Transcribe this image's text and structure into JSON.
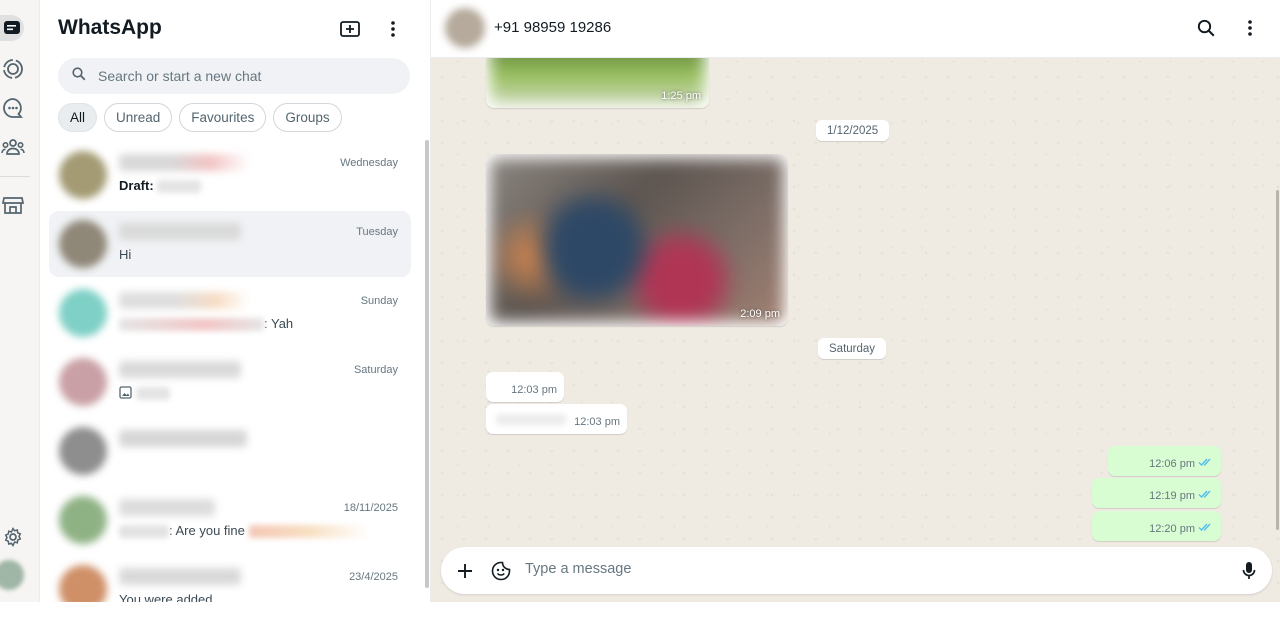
{
  "app": {
    "title": "WhatsApp"
  },
  "colors": {
    "accent": "#25d366",
    "outgoing_bubble": "#d9fdd3",
    "tick_blue": "#53bdeb",
    "wallpaper": "#efeae2"
  },
  "rail": {
    "items": [
      {
        "icon": "chats-icon",
        "active": true
      },
      {
        "icon": "status-icon"
      },
      {
        "icon": "channels-icon"
      },
      {
        "icon": "communities-icon"
      },
      {
        "icon": "business-tools-icon"
      }
    ],
    "bottom": [
      {
        "icon": "settings-icon"
      },
      {
        "icon": "profile-avatar"
      }
    ]
  },
  "sidebar": {
    "new_chat_icon": "new-chat-icon",
    "menu_icon": "menu-icon",
    "search_placeholder": "Search or start a new chat",
    "filters": [
      "All",
      "Unread",
      "Favourites",
      "Groups"
    ],
    "chats": [
      {
        "time": "Wednesday",
        "draft_label": "Draft:",
        "message": ""
      },
      {
        "time": "Tuesday",
        "message": "Hi"
      },
      {
        "time": "Sunday",
        "message": ": Yah"
      },
      {
        "time": "Saturday",
        "message": ""
      },
      {
        "time": "",
        "message": ""
      },
      {
        "time": "18/11/2025",
        "message": ": Are you fine"
      },
      {
        "time": "23/4/2025",
        "message": "You were added"
      }
    ]
  },
  "conversation": {
    "contact_name": "+91 98959 19286",
    "messages": [
      {
        "kind": "image",
        "time": "1:25 pm"
      },
      {
        "kind": "date",
        "label": "1/12/2025"
      },
      {
        "kind": "image",
        "time": "2:09 pm"
      },
      {
        "kind": "date",
        "label": "Saturday"
      },
      {
        "kind": "incoming",
        "time": "12:03 pm"
      },
      {
        "kind": "incoming",
        "time": "12:03 pm"
      },
      {
        "kind": "outgoing",
        "time": "12:06 pm",
        "status": "read"
      },
      {
        "kind": "outgoing",
        "time": "12:19 pm",
        "status": "read"
      },
      {
        "kind": "outgoing",
        "time": "12:20 pm",
        "status": "read"
      }
    ],
    "composer_placeholder": "Type a message"
  }
}
